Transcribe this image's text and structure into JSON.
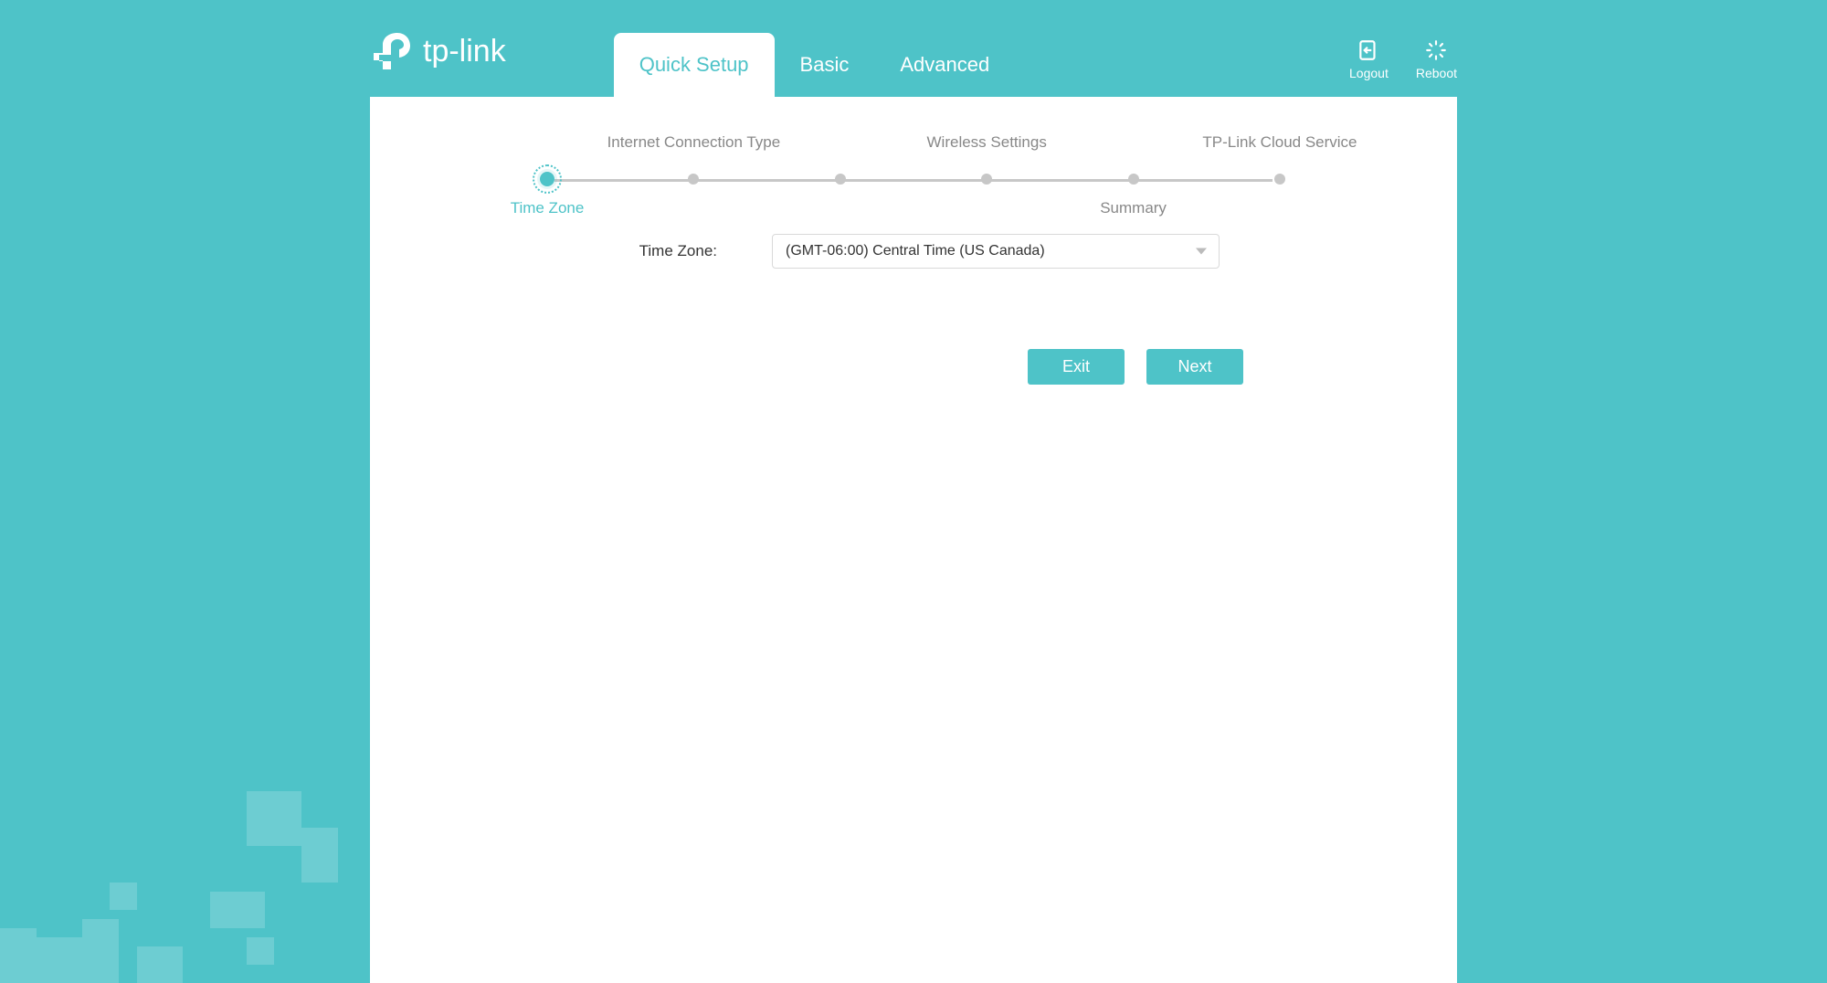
{
  "brand": "tp-link",
  "nav": {
    "tabs": [
      {
        "label": "Quick Setup",
        "active": true
      },
      {
        "label": "Basic",
        "active": false
      },
      {
        "label": "Advanced",
        "active": false
      }
    ]
  },
  "header_actions": {
    "logout": "Logout",
    "reboot": "Reboot"
  },
  "stepper": {
    "steps": [
      {
        "label": "Time Zone",
        "position": "bottom",
        "active": true
      },
      {
        "label": "Internet Connection Type",
        "position": "top",
        "active": false
      },
      {
        "label": "",
        "position": "none",
        "active": false
      },
      {
        "label": "Wireless Settings",
        "position": "top",
        "active": false
      },
      {
        "label": "Summary",
        "position": "bottom",
        "active": false
      },
      {
        "label": "TP-Link Cloud Service",
        "position": "top",
        "active": false
      }
    ]
  },
  "form": {
    "timezone_label": "Time Zone:",
    "timezone_value": "(GMT-06:00) Central Time (US Canada)"
  },
  "buttons": {
    "exit": "Exit",
    "next": "Next"
  }
}
